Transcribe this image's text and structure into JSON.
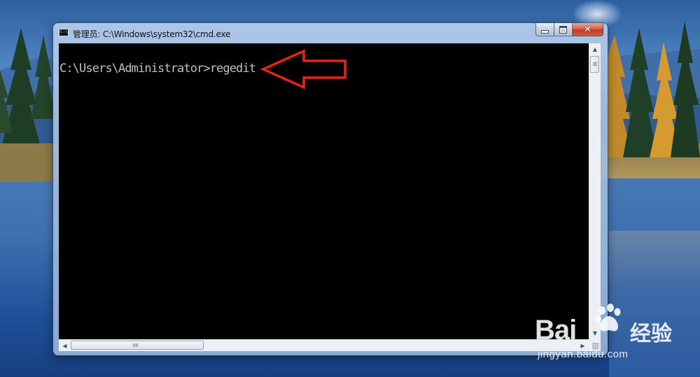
{
  "window": {
    "title": "管理员: C:\\Windows\\system32\\cmd.exe",
    "icon_text": "C:\\",
    "close_glyph": "✕"
  },
  "console": {
    "line": "C:\\Users\\Administrator>regedit"
  },
  "scrollbars": {
    "up_glyph": "▲",
    "down_glyph": "▼",
    "left_glyph": "◀",
    "right_glyph": "▶"
  },
  "watermark": {
    "logo": "Bai",
    "logo_suffix": "",
    "brand_cn": "经验",
    "url": "jingyan.baidu.com"
  },
  "colors": {
    "console_bg": "#000000",
    "console_text": "#c0c0c0",
    "arrow": "#e8221b"
  },
  "icons": [
    "cmd-window-icon",
    "minimize-icon",
    "maximize-icon",
    "close-icon",
    "red-arrow-icon",
    "baidu-paw-icon"
  ]
}
